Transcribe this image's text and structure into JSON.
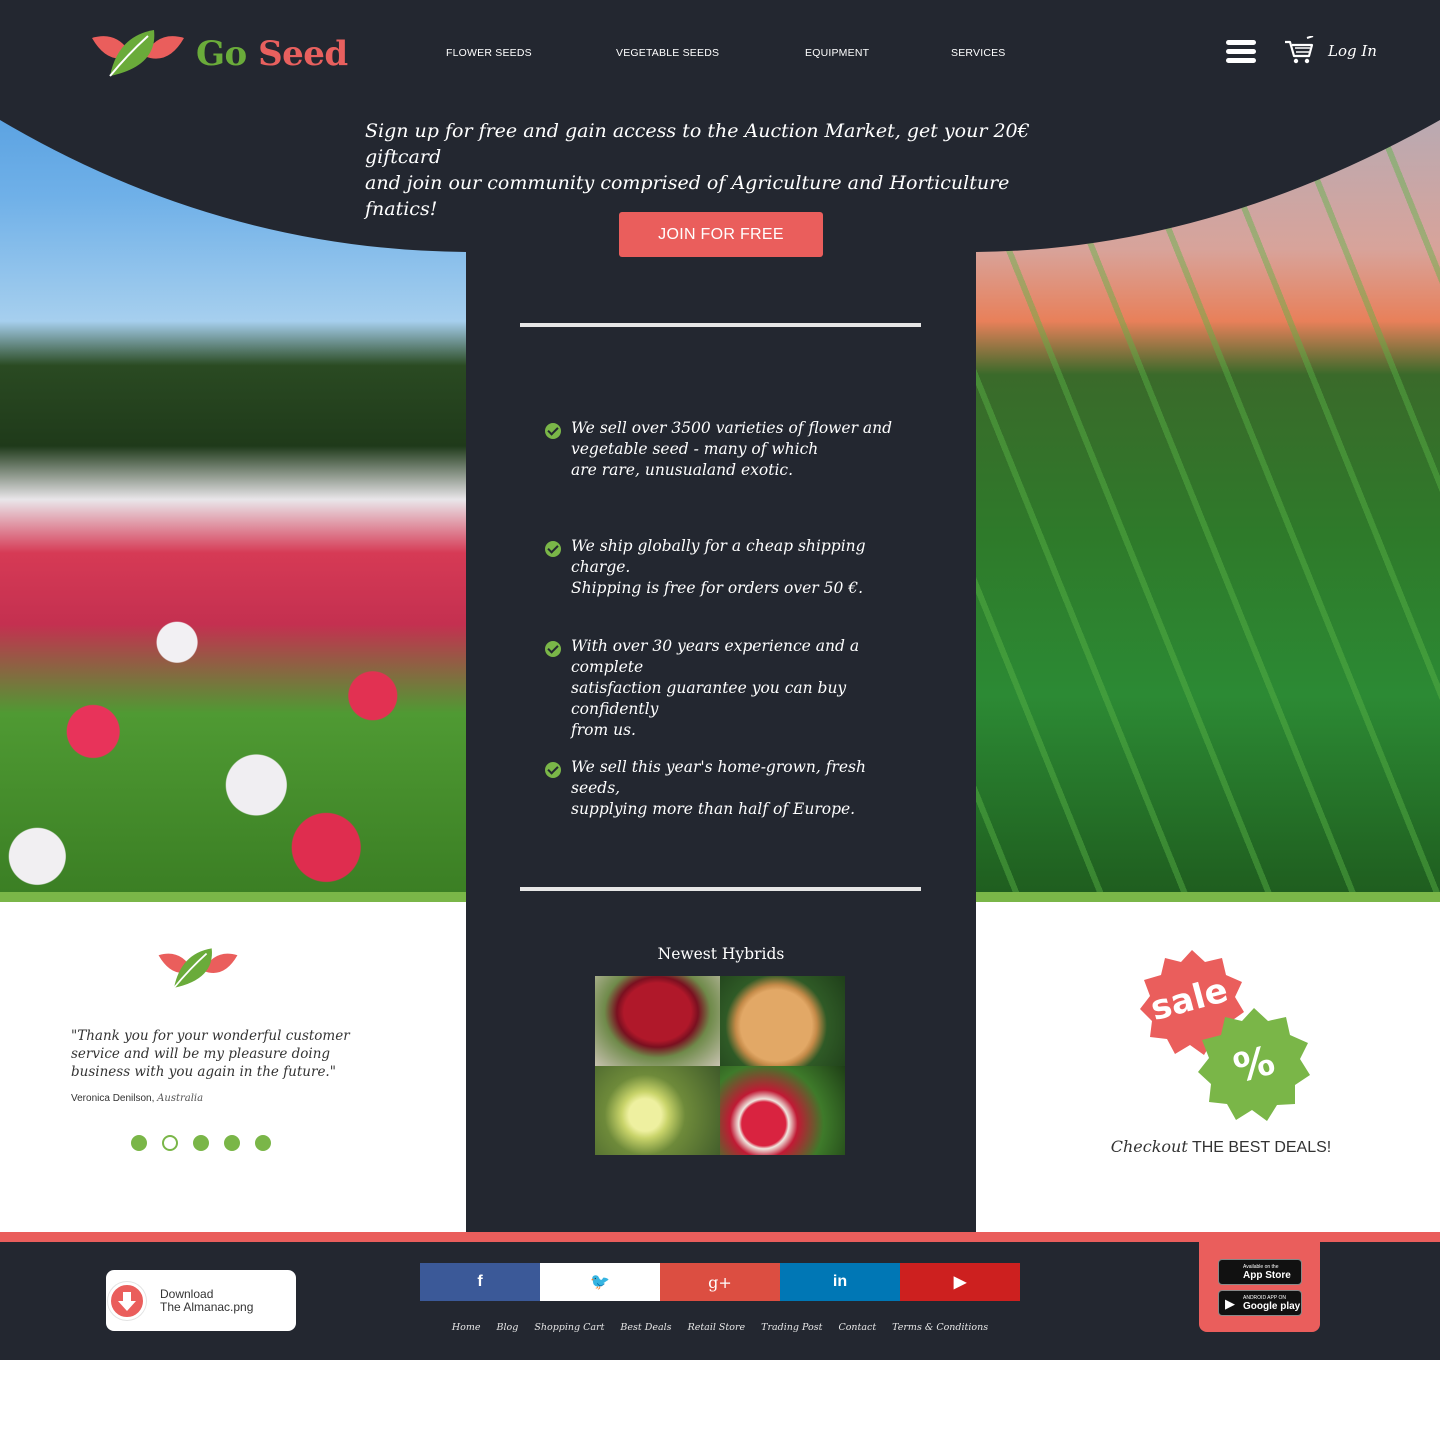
{
  "brand": {
    "go": "Go",
    "seed": "Seed",
    "accent_green": "#7ab648",
    "accent_red": "#ea5e5c",
    "dark": "#232730"
  },
  "nav": {
    "items": [
      "FLOWER SEEDS",
      "VEGETABLE SEEDS",
      "EQUIPMENT",
      "SERVICES"
    ],
    "menu_icon": "hamburger-icon",
    "cart_icon": "cart-icon",
    "login": "Log In"
  },
  "hero": {
    "tagline_line1": "Sign up for free and gain access to the Auction Market, get your 20€ giftcard",
    "tagline_line2": "and join our community comprised of Agriculture and Horticulture fnatics!",
    "join_button": "JOIN FOR FREE"
  },
  "features": [
    {
      "lines": [
        "We sell over 3500 varieties of flower and",
        "vegetable seed - many of which",
        "are rare, unusualand exotic."
      ]
    },
    {
      "lines": [
        "We ship globally for a cheap shipping charge.",
        "Shipping is free for orders over  50 €."
      ]
    },
    {
      "lines": [
        "With over 30 years experience and a complete",
        "satisfaction guarantee you can buy confidently",
        "from us."
      ]
    },
    {
      "lines": [
        "We sell this year's home-grown, fresh seeds,",
        "supplying more than half of Europe."
      ]
    }
  ],
  "hybrids": {
    "title": "Newest Hybrids"
  },
  "testimonial": {
    "quote_line1": "\"Thank you for your wonderful customer",
    "quote_line2": "service and will be my pleasure doing",
    "quote_line3": "business with you again in the future.\"",
    "author": "Veronica Denilson",
    "country": "Australia",
    "active_slide": 2,
    "slide_count": 5
  },
  "deals": {
    "sale_badge": "sale",
    "percent_badge": "%",
    "checkout": "Checkout",
    "best": "THE BEST DEALS!"
  },
  "footer": {
    "download_line1": "Download",
    "download_line2": "The Almanac.png",
    "social": [
      {
        "name": "facebook-icon",
        "glyph": "f"
      },
      {
        "name": "twitter-icon",
        "glyph": "🐦"
      },
      {
        "name": "google-plus-icon",
        "glyph": "g+"
      },
      {
        "name": "linkedin-icon",
        "glyph": "in"
      },
      {
        "name": "youtube-icon",
        "glyph": "▶"
      }
    ],
    "links": [
      "Home",
      "Blog",
      "Shopping Cart",
      "Best Deals",
      "Retail Store",
      "Trading Post",
      "Contact",
      "Terms & Conditions"
    ],
    "appstore_small": "Available on the",
    "appstore_big": "App Store",
    "googleplay_small": "ANDROID APP ON",
    "googleplay_big": "Google play"
  }
}
